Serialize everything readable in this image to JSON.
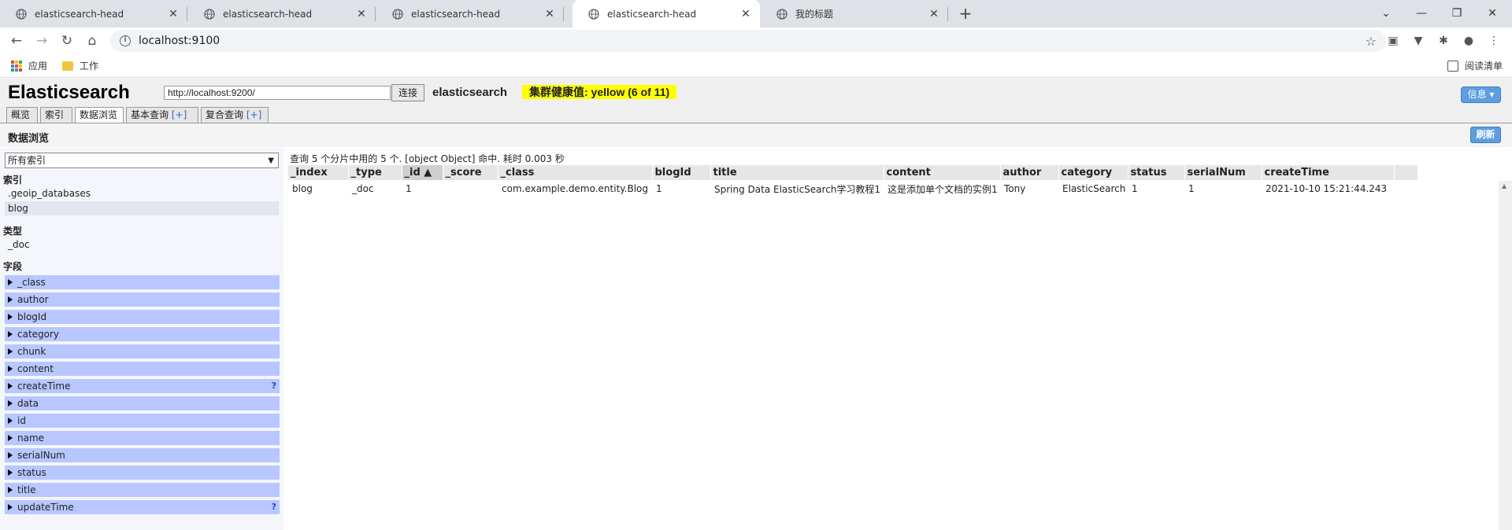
{
  "browser": {
    "tabs": [
      {
        "title": "elasticsearch-head",
        "active": false
      },
      {
        "title": "elasticsearch-head",
        "active": false
      },
      {
        "title": "elasticsearch-head",
        "active": false
      },
      {
        "title": "elasticsearch-head",
        "active": true
      },
      {
        "title": "我的标题",
        "active": false
      }
    ],
    "address": "localhost:9100",
    "bookmarks": {
      "apps": "应用",
      "work": "工作",
      "reading_list": "阅读清单"
    }
  },
  "es": {
    "title": "Elasticsearch",
    "cluster_url": "http://localhost:9200/",
    "connect_label": "连接",
    "cluster_name": "elasticsearch",
    "health": "集群健康值: yellow (6 of 11)",
    "info_label": "信息 ▾",
    "tabs": [
      {
        "label": "概览",
        "plus": ""
      },
      {
        "label": "索引",
        "plus": ""
      },
      {
        "label": "数据浏览",
        "plus": ""
      },
      {
        "label": "基本查询",
        "plus": "[+]"
      },
      {
        "label": "复合查询",
        "plus": "[+]"
      }
    ],
    "section_title": "数据浏览",
    "refresh_label": "刷新"
  },
  "sidebar": {
    "select_value": "所有索引",
    "index_head": "索引",
    "indices": [
      ".geoip_databases",
      "blog"
    ],
    "type_head": "类型",
    "types": [
      "_doc"
    ],
    "field_head": "字段",
    "fields": [
      "_class",
      "author",
      "blogId",
      "category",
      "chunk",
      "content",
      "createTime",
      "data",
      "id",
      "name",
      "serialNum",
      "status",
      "title",
      "updateTime"
    ],
    "help_mark": "?"
  },
  "results": {
    "query_info": "查询 5 个分片中用的 5 个. [object Object] 命中. 耗时 0.003 秒",
    "columns": [
      "_index",
      "_type",
      "_id ▲",
      "_score",
      "_class",
      "blogId",
      "title",
      "content",
      "author",
      "category",
      "status",
      "serialNum",
      "createTime"
    ],
    "rows": [
      [
        "blog",
        "_doc",
        "1",
        "",
        "com.example.demo.entity.Blog",
        "1",
        "Spring Data ElasticSearch学习教程1",
        "这是添加单个文档的实例1",
        "Tony",
        "ElasticSearch",
        "1",
        "1",
        "2021-10-10 15:21:44.243"
      ]
    ]
  }
}
